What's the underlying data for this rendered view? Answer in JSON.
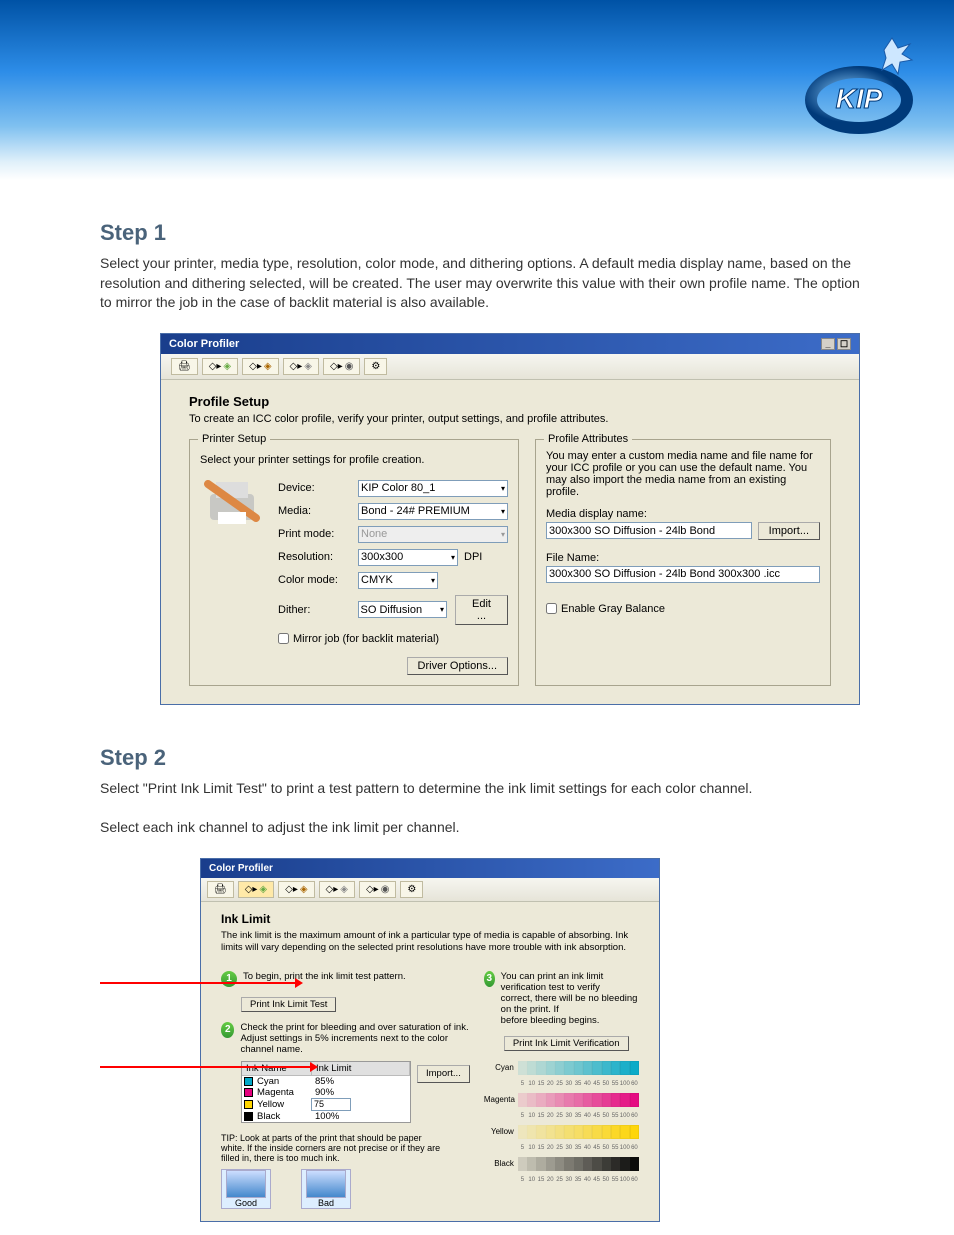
{
  "page": {
    "step1_heading": "Step 1",
    "step1_body": "Select your printer, media type, resolution, color mode, and dithering options. A default media display name, based on the resolution and dithering selected, will be created. The user may overwrite this value with their own profile name. The option to mirror the job in the case of backlit material is also available.",
    "step2_heading": "Step 2",
    "step2_body_a": "Select \"Print Ink Limit Test\" to print a test pattern to determine the ink limit settings for each color channel.",
    "step2_body_b": "Select each ink channel to adjust the ink limit per channel."
  },
  "dialog1": {
    "title": "Color Profiler",
    "section_title": "Profile Setup",
    "section_sub": "To create an ICC color profile, verify your printer, output settings, and profile attributes.",
    "printer_setup": {
      "legend": "Printer Setup",
      "instruction": "Select your printer settings for profile creation.",
      "device_label": "Device:",
      "device_value": "KIP Color 80_1",
      "media_label": "Media:",
      "media_value": "Bond - 24# PREMIUM",
      "printmode_label": "Print mode:",
      "printmode_value": "None",
      "resolution_label": "Resolution:",
      "resolution_value": "300x300",
      "resolution_unit": "DPI",
      "colormode_label": "Color mode:",
      "colormode_value": "CMYK",
      "dither_label": "Dither:",
      "dither_value": "SO Diffusion",
      "edit_btn": "Edit ...",
      "mirror_label": "Mirror job (for backlit material)",
      "driver_options_btn": "Driver Options..."
    },
    "profile_attr": {
      "legend": "Profile Attributes",
      "desc": "You may enter a custom media name and file name for your ICC profile or you can use the default name. You may also import the media name from an existing profile.",
      "media_display_label": "Media display name:",
      "media_display_value": "300x300 SO Diffusion - 24lb Bond",
      "import_btn": "Import...",
      "filename_label": "File Name:",
      "filename_value": "300x300 SO Diffusion - 24lb Bond 300x300 .icc",
      "gray_balance_label": "Enable Gray Balance"
    }
  },
  "dialog2": {
    "title": "Color Profiler",
    "section_title": "Ink Limit",
    "section_sub": "The ink limit is the maximum amount of ink a particular type of media is capable of absorbing. Ink limits will vary depending on the selected print resolutions have more trouble with ink absorption.",
    "step1_text": "To begin, print the ink limit test pattern.",
    "print_test_btn": "Print Ink Limit Test",
    "step2_text_a": "Check the print for bleeding and over saturation of ink.",
    "step2_text_b": "Adjust settings in 5% increments next to the color channel name.",
    "step3_text_a": "You can print an ink limit verification test to verify",
    "step3_text_b": "correct, there will be no bleeding on the print. If",
    "step3_text_c": "before bleeding begins.",
    "print_verify_btn": "Print Ink Limit Verification",
    "import_btn": "Import...",
    "inks_header_name": "Ink Name",
    "inks_header_limit": "Ink Limit",
    "inks": [
      {
        "name": "Cyan",
        "limit": "85%",
        "color": "#00a8c8"
      },
      {
        "name": "Magenta",
        "limit": "90%",
        "color": "#e5007e"
      },
      {
        "name": "Yellow",
        "limit": "75",
        "color": "#ffd500"
      },
      {
        "name": "Black",
        "limit": "100%",
        "color": "#000000"
      }
    ],
    "tip": "TIP: Look at parts of the print that should be paper white. If the inside corners are not precise or if they are filled in, there is too much ink.",
    "good_label": "Good",
    "bad_label": "Bad",
    "ticks": [
      "5",
      "10",
      "15",
      "20",
      "25",
      "30",
      "35",
      "40",
      "45",
      "50",
      "55",
      "100",
      "60"
    ],
    "grad_labels": [
      "Cyan",
      "Magenta",
      "Yellow",
      "Black"
    ]
  }
}
